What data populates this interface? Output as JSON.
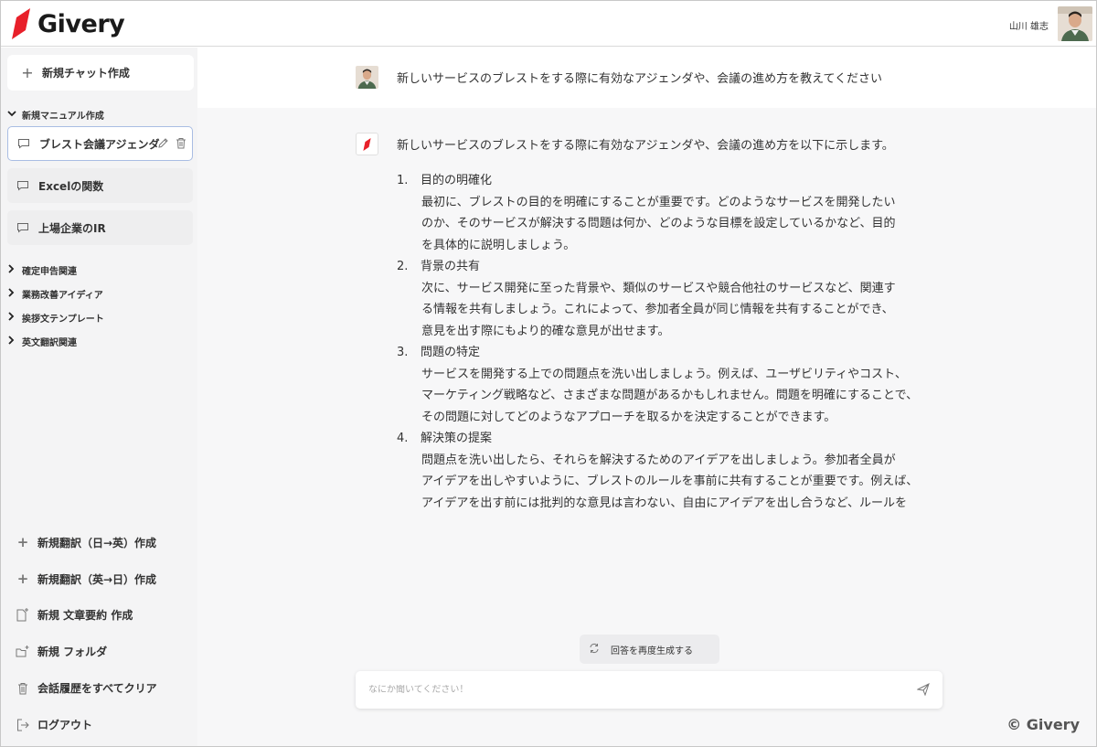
{
  "header": {
    "logo_text": "Givery",
    "user_name": "山川 雄志"
  },
  "sidebar": {
    "new_chat_label": "新規チャット作成",
    "open_folder": {
      "label": "新規マニュアル作成",
      "items": [
        {
          "label": "ブレスト会議アジェンダ",
          "active": true
        },
        {
          "label": "Excelの関数",
          "active": false
        },
        {
          "label": "上場企業のIR",
          "active": false
        }
      ]
    },
    "folders": [
      "確定申告関連",
      "業務改善アイディア",
      "挨拶文テンプレート",
      "英文翻訳関連"
    ],
    "bottom": {
      "translate_je": "新規翻訳（日→英）作成",
      "translate_ej": "新規翻訳（英→日）作成",
      "summary": "新規 文章要約 作成",
      "new_folder": "新規 フォルダ",
      "clear_history": "会話履歴をすべてクリア",
      "logout": "ログアウト"
    }
  },
  "conversation": {
    "user_message": "新しいサービスのブレストをする際に有効なアジェンダや、会議の進め方を教えてください",
    "ai_intro": "新しいサービスのブレストをする際に有効なアジェンダや、会議の進め方を以下に示します。",
    "ai_list": [
      {
        "num": "1.",
        "title": "目的の明確化",
        "body": "最初に、ブレストの目的を明確にすることが重要です。どのようなサービスを開発したい\nのか、そのサービスが解決する問題は何か、どのような目標を設定しているかなど、目的\nを具体的に説明しましょう。"
      },
      {
        "num": "2.",
        "title": "背景の共有",
        "body": "次に、サービス開発に至った背景や、類似のサービスや競合他社のサービスなど、関連す\nる情報を共有しましょう。これによって、参加者全員が同じ情報を共有することができ、\n意見を出す際にもより的確な意見が出せます。"
      },
      {
        "num": "3.",
        "title": "問題の特定",
        "body": "サービスを開発する上での問題点を洗い出しましょう。例えば、ユーザビリティやコスト、\nマーケティング戦略など、さまざまな問題があるかもしれません。問題を明確にすることで、\nその問題に対してどのようなアプローチを取るかを決定することができます。"
      },
      {
        "num": "4.",
        "title": "解決策の提案",
        "body": "問題点を洗い出したら、それらを解決するためのアイデアを出しましょう。参加者全員が\nアイデアを出しやすいように、ブレストのルールを事前に共有することが重要です。例えば、\nアイデアを出す前には批判的な意見は言わない、自由にアイデアを出し合うなど、ルールを"
      }
    ],
    "regenerate_label": "回答を再度生成する",
    "input_placeholder": "なにか聞いてください！"
  },
  "copyright": "© Givery",
  "colors": {
    "brand_red": "#e8202a",
    "active_border": "#a9bde3",
    "sidebar_bg": "#f4f4f5"
  }
}
